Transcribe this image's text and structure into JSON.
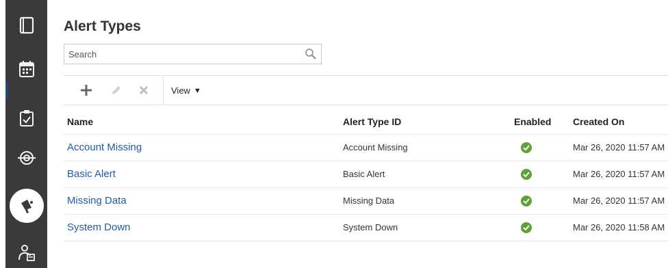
{
  "page": {
    "title": "Alert Types"
  },
  "search": {
    "placeholder": "Search",
    "value": ""
  },
  "toolbar": {
    "add_icon": "plus-icon",
    "edit_icon": "pencil-icon",
    "delete_icon": "x-icon",
    "view_label": "View"
  },
  "rail": {
    "items": [
      {
        "icon": "book-icon"
      },
      {
        "icon": "calendar-icon"
      },
      {
        "icon": "clipboard-check-icon"
      },
      {
        "icon": "target-icon"
      },
      {
        "icon": "megaphone-icon",
        "active": true
      },
      {
        "icon": "user-report-icon"
      }
    ]
  },
  "table": {
    "columns": [
      "Name",
      "Alert Type ID",
      "Enabled",
      "Created On"
    ],
    "rows": [
      {
        "name": "Account Missing",
        "id": "Account Missing",
        "enabled": true,
        "created": "Mar 26, 2020 11:57 AM"
      },
      {
        "name": "Basic Alert",
        "id": "Basic Alert",
        "enabled": true,
        "created": "Mar 26, 2020 11:57 AM"
      },
      {
        "name": "Missing Data",
        "id": "Missing Data",
        "enabled": true,
        "created": "Mar 26, 2020 11:57 AM"
      },
      {
        "name": "System Down",
        "id": "System Down",
        "enabled": true,
        "created": "Mar 26, 2020 11:58 AM"
      }
    ]
  },
  "colors": {
    "rail_bg": "#3a3a3a",
    "link": "#1f5ba8",
    "enabled_check": "#5aa334"
  }
}
